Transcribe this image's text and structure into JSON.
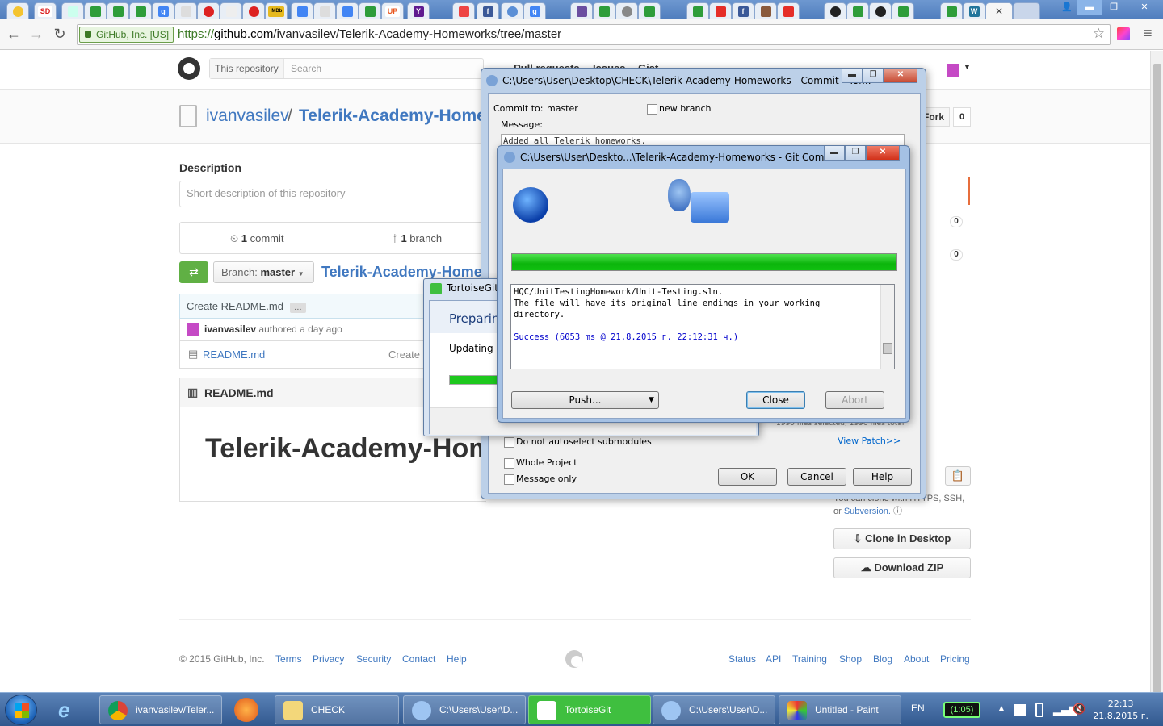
{
  "browser": {
    "ev_label": "GitHub, Inc. [US]",
    "url_scheme": "https://",
    "url_host": "github.com",
    "url_path": "/ivanvasilev/Telerik-Academy-Homeworks/tree/master",
    "tab_favicons": [
      "SD",
      "g",
      "IMDb",
      "UP",
      "Y",
      "f",
      "g",
      "f",
      "g",
      "W"
    ]
  },
  "github": {
    "search_scope": "This repository",
    "search_placeholder": "Search",
    "nav": [
      "Pull requests",
      "Issues",
      "Gist"
    ],
    "owner": "ivanvasilev",
    "separator": "/",
    "repo": "Telerik-Academy-Homeworks",
    "fork_label": "Fork",
    "fork_count": "0",
    "count2": "0",
    "count3": "0",
    "description_label": "Description",
    "description_placeholder": "Short description of this repository",
    "commits_count": "1",
    "commits_label": "commit",
    "branches_count": "1",
    "branches_label": "branch",
    "branch_prefix": "Branch:",
    "branch_name": "master",
    "breadcrumb_repo": "Telerik-Academy-Homeworks",
    "commit_message": "Create README.md",
    "commit_ellipsis": "…",
    "author": "ivanvasilev",
    "authored_text": "authored a day ago",
    "file_name": "README.md",
    "file_commit": "Create README.md",
    "readme_title": "README.md",
    "readme_h1": "Telerik-Academy-Homeworks",
    "clone_note_prefix": "You can clone with HTTPS, SSH,",
    "clone_note_or": "or",
    "clone_note_link": "Subversion.",
    "clone_desktop": "Clone in Desktop",
    "download_zip": "Download ZIP",
    "copyright": "© 2015 GitHub, Inc.",
    "footer_left": [
      "Terms",
      "Privacy",
      "Security",
      "Contact",
      "Help"
    ],
    "footer_right": [
      "Status",
      "API",
      "Training",
      "Shop",
      "Blog",
      "About",
      "Pricing"
    ]
  },
  "commit_dialog": {
    "title": "C:\\Users\\User\\Desktop\\CHECK\\Telerik-Academy-Homeworks - Commit - Tor...",
    "commit_to_label": "Commit to:",
    "commit_to_value": "master",
    "new_branch": "new branch",
    "message_label": "Message:",
    "message_text": "Added all Telerik homeworks.",
    "files_selected": "1990 files selected, 1990 files total",
    "view_patch": "View Patch>>",
    "no_autoselect": "Do not autoselect submodules",
    "whole_project": "Whole Project",
    "message_only": "Message only",
    "ok": "OK",
    "cancel": "Cancel",
    "help": "Help"
  },
  "tortoise_dialog": {
    "title": "TortoiseGit",
    "heading": "Preparing...",
    "status": "Updating index..."
  },
  "git_dialog": {
    "title": "C:\\Users\\User\\Deskto...\\Telerik-Academy-Homeworks - Git Comman...",
    "progress_percent": 100,
    "log_line1": "HQC/UnitTestingHomework/Unit-Testing.sln.",
    "log_line2": "The file will have its original line endings in your working",
    "log_line3": "directory.",
    "log_success": "Success (6053 ms @ 21.8.2015 г. 22:12:31 ч.)",
    "push": "Push...",
    "close": "Close",
    "abort": "Abort"
  },
  "taskbar": {
    "items": [
      "ivanvasilev/Teler...",
      "CHECK",
      "C:\\Users\\User\\D...",
      "TortoiseGit",
      "C:\\Users\\User\\D...",
      "Untitled - Paint"
    ],
    "lang": "EN",
    "battery": "(1:05)",
    "time": "22:13",
    "date": "21.8.2015 г."
  },
  "colors": {
    "github_link": "#4078c0",
    "progress_green": "#1ec81e",
    "taskbar": "#31588e",
    "active_task": "#3fbf3f"
  }
}
